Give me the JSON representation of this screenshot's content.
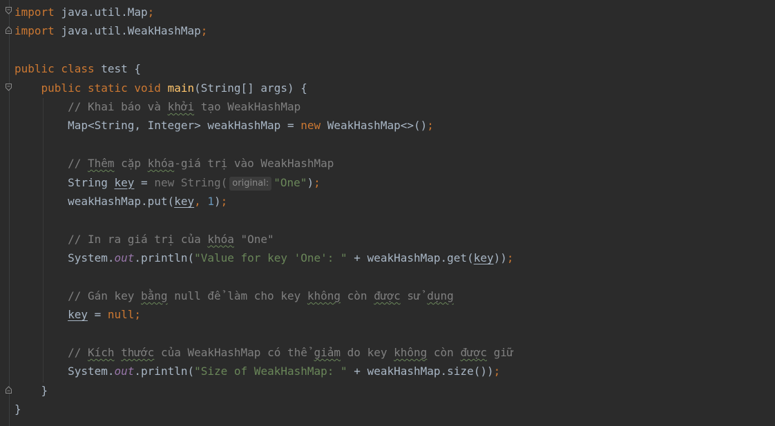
{
  "editor": {
    "language": "java",
    "lines": [
      [
        [
          "kw",
          "import"
        ],
        [
          "t",
          " java.util.Map"
        ],
        [
          "kw",
          ";"
        ]
      ],
      [
        [
          "kw",
          "import"
        ],
        [
          "t",
          " java.util.WeakHashMap"
        ],
        [
          "kw",
          ";"
        ]
      ],
      [],
      [
        [
          "kw",
          "public class "
        ],
        [
          "t",
          "test {"
        ]
      ],
      [
        [
          "t",
          "    "
        ],
        [
          "kw",
          "public static void "
        ],
        [
          "fn",
          "main"
        ],
        [
          "t",
          "(String[] args) {"
        ]
      ],
      [
        [
          "t",
          "        "
        ],
        [
          "cm",
          "// Khai báo và "
        ],
        [
          "cmw",
          "khởi"
        ],
        [
          "cm",
          " tạo WeakHashMap"
        ]
      ],
      [
        [
          "t",
          "        Map<String, Integer> weakHashMap = "
        ],
        [
          "kw",
          "new "
        ],
        [
          "t",
          "WeakHashMap<>()"
        ],
        [
          "kw",
          ";"
        ]
      ],
      [],
      [
        [
          "t",
          "        "
        ],
        [
          "cm",
          "// "
        ],
        [
          "cmw",
          "Thêm"
        ],
        [
          "cm",
          " cặp "
        ],
        [
          "cmw",
          "khóa"
        ],
        [
          "cm",
          "-giá trị vào WeakHashMap"
        ]
      ],
      [
        [
          "t",
          "        String "
        ],
        [
          "ul",
          "key"
        ],
        [
          "t",
          " = "
        ],
        [
          "dim",
          "new String("
        ],
        [
          "hint",
          "original:"
        ],
        [
          "str",
          "\"One\""
        ],
        [
          "t",
          ")"
        ],
        [
          "kw",
          ";"
        ]
      ],
      [
        [
          "t",
          "        weakHashMap.put("
        ],
        [
          "ul",
          "key"
        ],
        [
          "kw",
          ", "
        ],
        [
          "num",
          "1"
        ],
        [
          "t",
          ")"
        ],
        [
          "kw",
          ";"
        ]
      ],
      [],
      [
        [
          "t",
          "        "
        ],
        [
          "cm",
          "// In ra giá trị của "
        ],
        [
          "cmw",
          "khóa"
        ],
        [
          "cm",
          " \"One\""
        ]
      ],
      [
        [
          "t",
          "        System."
        ],
        [
          "st",
          "out"
        ],
        [
          "t",
          ".println("
        ],
        [
          "str",
          "\"Value for key 'One': \""
        ],
        [
          "t",
          " + weakHashMap.get("
        ],
        [
          "ul",
          "key"
        ],
        [
          "t",
          "))"
        ],
        [
          "kw",
          ";"
        ]
      ],
      [],
      [
        [
          "t",
          "        "
        ],
        [
          "cm",
          "// Gán key "
        ],
        [
          "cmw",
          "bằng"
        ],
        [
          "cm",
          " null để làm cho key "
        ],
        [
          "cmw",
          "không"
        ],
        [
          "cm",
          " còn "
        ],
        [
          "cmw",
          "được"
        ],
        [
          "cm",
          " sử "
        ],
        [
          "cmw",
          "dụng"
        ]
      ],
      [
        [
          "t",
          "        "
        ],
        [
          "ul",
          "key"
        ],
        [
          "t",
          " = "
        ],
        [
          "kw",
          "null;"
        ]
      ],
      [],
      [
        [
          "t",
          "        "
        ],
        [
          "cm",
          "// "
        ],
        [
          "cmw",
          "Kích"
        ],
        [
          "cm",
          " "
        ],
        [
          "cmw",
          "thước"
        ],
        [
          "cm",
          " của WeakHashMap có thể "
        ],
        [
          "cmw",
          "giảm"
        ],
        [
          "cm",
          " do key "
        ],
        [
          "cmw",
          "không"
        ],
        [
          "cm",
          " còn "
        ],
        [
          "cmw",
          "được"
        ],
        [
          "cm",
          " giữ"
        ]
      ],
      [
        [
          "t",
          "        System."
        ],
        [
          "st",
          "out"
        ],
        [
          "t",
          ".println("
        ],
        [
          "str",
          "\"Size of WeakHashMap: \""
        ],
        [
          "t",
          " + weakHashMap.size())"
        ],
        [
          "kw",
          ";"
        ]
      ],
      [
        [
          "t",
          "    }"
        ]
      ],
      [
        [
          "t",
          "}"
        ]
      ]
    ]
  },
  "colors": {
    "background": "#2b2b2b",
    "keyword": "#cc7832",
    "function": "#ffc66d",
    "comment": "#808080",
    "string": "#6a8759",
    "number": "#6897bb",
    "static_field": "#9876aa",
    "text": "#a9b7c6"
  },
  "gutter": {
    "fold_icons": [
      "fold-open-icon",
      "fold-close-icon"
    ]
  }
}
